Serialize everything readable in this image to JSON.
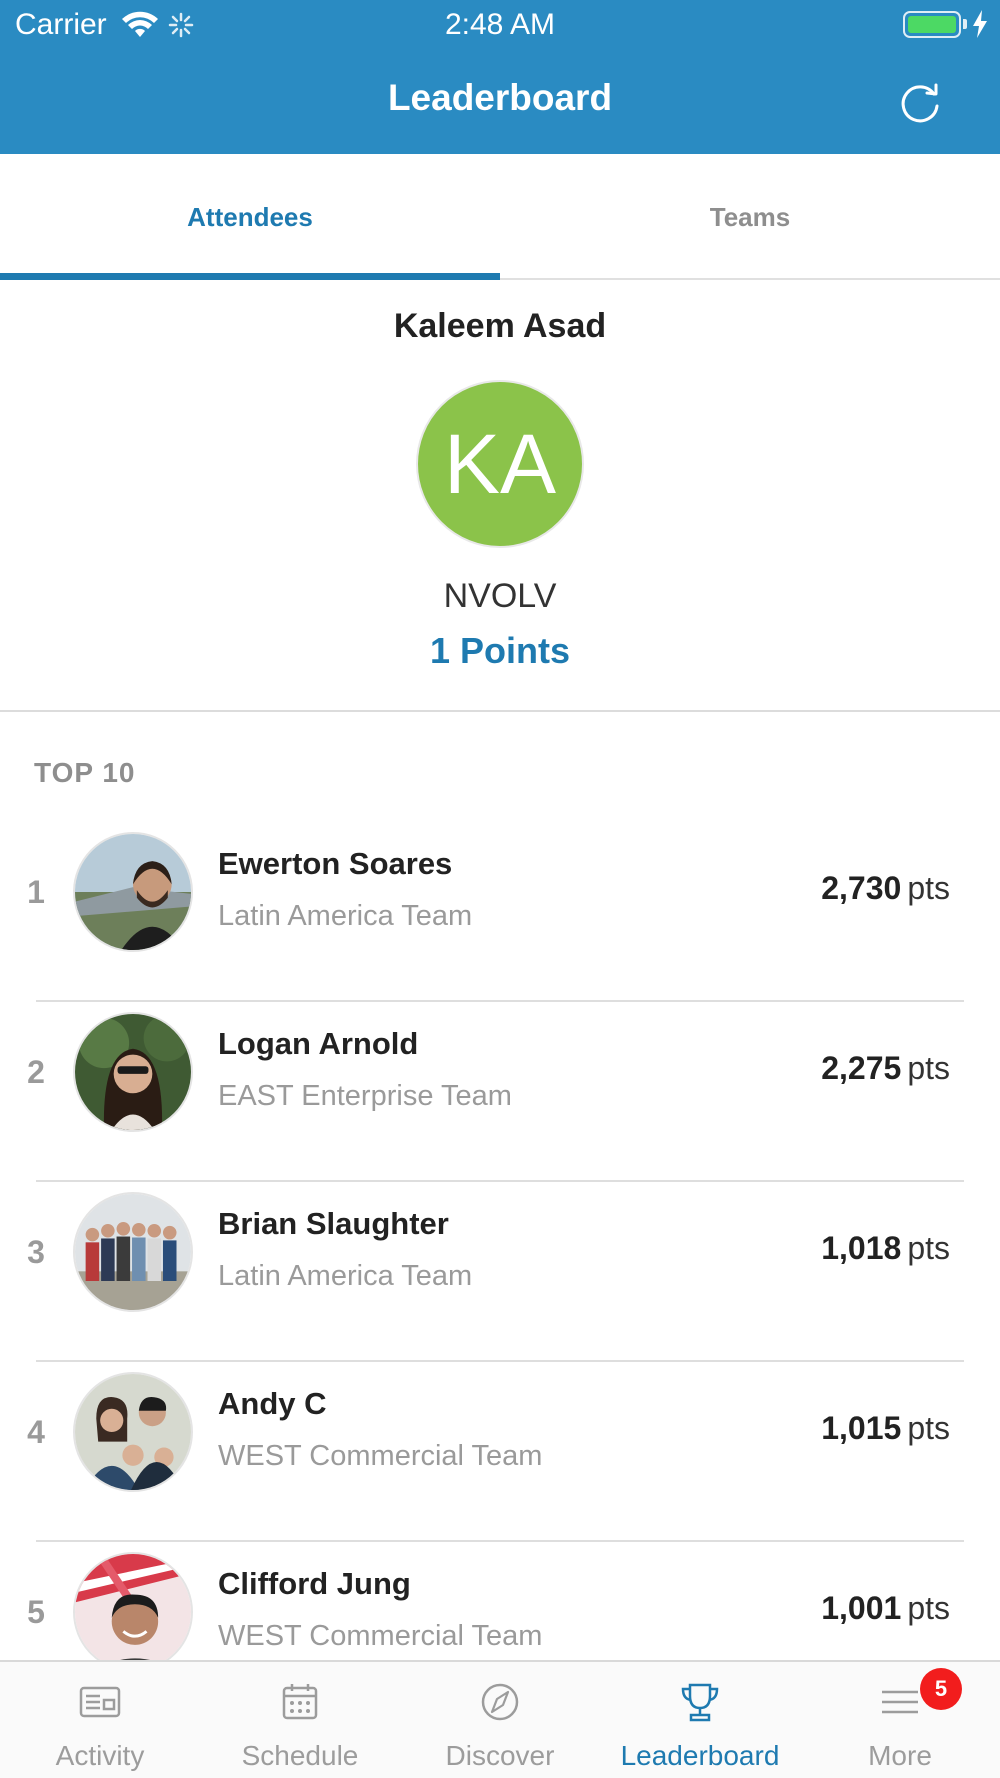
{
  "status_bar": {
    "carrier": "Carrier",
    "time": "2:48 AM",
    "battery_level": 1.0
  },
  "header": {
    "title": "Leaderboard",
    "refresh_icon": "refresh-icon",
    "background_color": "#2a8bc2"
  },
  "tabs": [
    {
      "label": "Attendees",
      "active": true
    },
    {
      "label": "Teams",
      "active": false
    }
  ],
  "profile": {
    "name": "Kaleem Asad",
    "initials": "KA",
    "avatar_color": "#8bc34a",
    "team": "NVOLV",
    "points": "1 Points"
  },
  "list": {
    "section_title": "TOP 10",
    "points_unit": "pts",
    "rows": [
      {
        "rank": "1",
        "name": "Ewerton Soares",
        "team": "Latin America Team",
        "points": "2,730"
      },
      {
        "rank": "2",
        "name": "Logan Arnold",
        "team": "EAST Enterprise Team",
        "points": "2,275"
      },
      {
        "rank": "3",
        "name": "Brian Slaughter",
        "team": "Latin America Team",
        "points": "1,018"
      },
      {
        "rank": "4",
        "name": "Andy C",
        "team": "WEST Commercial Team",
        "points": "1,015"
      },
      {
        "rank": "5",
        "name": "Clifford Jung",
        "team": "WEST Commercial Team",
        "points": "1,001"
      }
    ]
  },
  "bottom_nav": {
    "items": [
      {
        "label": "Activity",
        "icon": "activity-icon",
        "active": false
      },
      {
        "label": "Schedule",
        "icon": "calendar-icon",
        "active": false
      },
      {
        "label": "Discover",
        "icon": "compass-icon",
        "active": false
      },
      {
        "label": "Leaderboard",
        "icon": "trophy-icon",
        "active": true
      },
      {
        "label": "More",
        "icon": "menu-icon",
        "active": false,
        "badge": "5"
      }
    ],
    "active_color": "#1e7ab0",
    "badge_color": "#f21d1d"
  }
}
